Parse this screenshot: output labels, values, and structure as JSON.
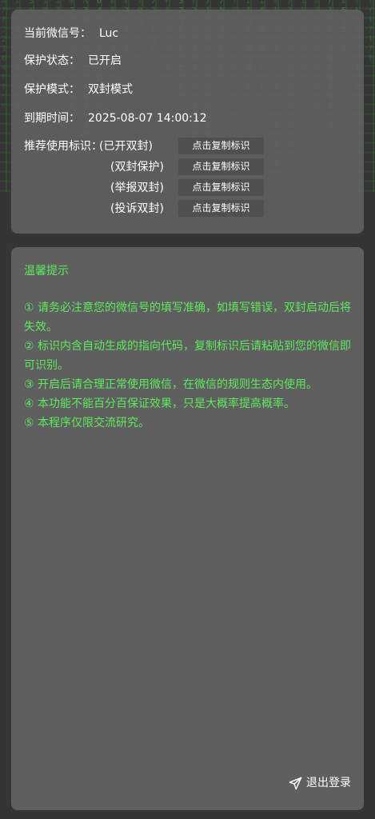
{
  "account": {
    "wechat_label": "当前微信号：",
    "wechat_value": "Luc",
    "status_label": "保护状态：",
    "status_value": "已开启",
    "mode_label": "保护模式：",
    "mode_value": "双封模式",
    "expire_label": "到期时间：",
    "expire_value": "2025-08-07 14:00:12"
  },
  "tags": {
    "label": "推荐使用标识：",
    "button_label": "点击复制标识",
    "items": [
      {
        "name": "(已开双封)"
      },
      {
        "name": "(双封保护)"
      },
      {
        "name": "(举报双封)"
      },
      {
        "name": "(投诉双封)"
      }
    ]
  },
  "tips": {
    "title": "温馨提示",
    "items": [
      "① 请务必注意您的微信号的填写准确，如填写错误，双封启动后将失效。",
      "② 标识内含自动生成的指向代码，复制标识后请粘贴到您的微信即可识别。",
      "③ 开启后请合理正常使用微信，在微信的规则生态内使用。",
      "④ 本功能不能百分百保证效果，只是大概率提高概率。",
      "⑤ 本程序仅限交流研究。"
    ]
  },
  "footer": {
    "logout_label": "退出登录",
    "logout_icon": "send-icon"
  },
  "colors": {
    "accent_green": "#5eea5e",
    "card_bg": "#5f5f5f",
    "page_bg": "#353535",
    "button_bg": "#505050"
  }
}
